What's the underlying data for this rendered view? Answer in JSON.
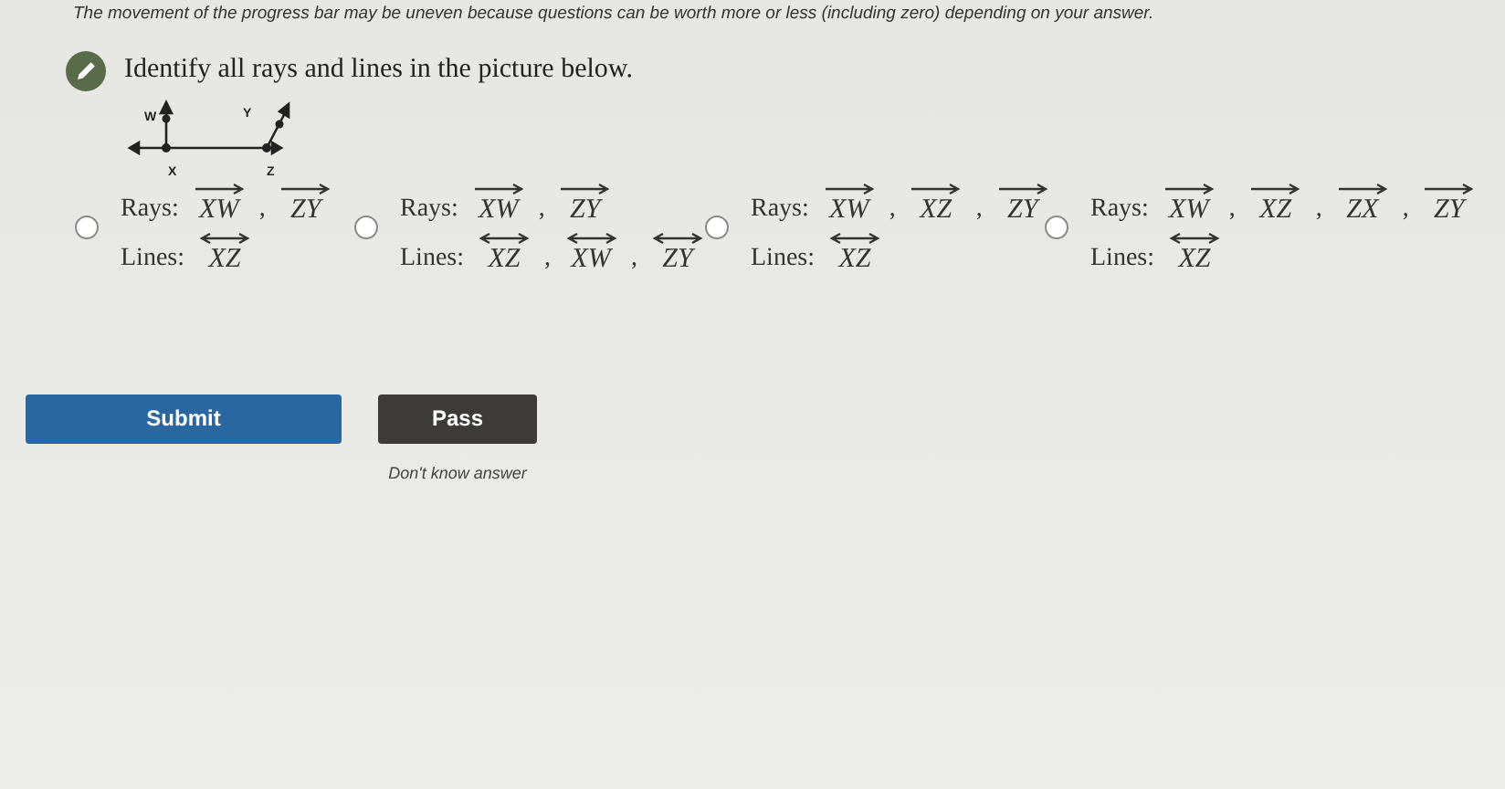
{
  "notice": "The movement of the progress bar may be uneven because questions can be worth more or less (including zero) depending on your answer.",
  "question": "Identify all rays and lines in the picture below.",
  "figure": {
    "labels": [
      "W",
      "Y",
      "X",
      "Z"
    ]
  },
  "separator": ",",
  "options": [
    {
      "selected": false,
      "rows": [
        {
          "label": "Rays:",
          "items": [
            {
              "name": "XW",
              "kind": "ray"
            },
            {
              "name": "ZY",
              "kind": "ray"
            }
          ]
        },
        {
          "label": "Lines:",
          "items": [
            {
              "name": "XZ",
              "kind": "line"
            }
          ]
        }
      ]
    },
    {
      "selected": false,
      "rows": [
        {
          "label": "Rays:",
          "items": [
            {
              "name": "XW",
              "kind": "ray"
            },
            {
              "name": "ZY",
              "kind": "ray"
            }
          ]
        },
        {
          "label": "Lines:",
          "items": [
            {
              "name": "XZ",
              "kind": "line"
            },
            {
              "name": "XW",
              "kind": "line"
            },
            {
              "name": "ZY",
              "kind": "line"
            }
          ]
        }
      ]
    },
    {
      "selected": false,
      "rows": [
        {
          "label": "Rays:",
          "items": [
            {
              "name": "XW",
              "kind": "ray"
            },
            {
              "name": "XZ",
              "kind": "ray"
            },
            {
              "name": "ZY",
              "kind": "ray"
            }
          ]
        },
        {
          "label": "Lines:",
          "items": [
            {
              "name": "XZ",
              "kind": "line"
            }
          ]
        }
      ]
    },
    {
      "selected": false,
      "rows": [
        {
          "label": "Rays:",
          "items": [
            {
              "name": "XW",
              "kind": "ray"
            },
            {
              "name": "XZ",
              "kind": "ray"
            },
            {
              "name": "ZX",
              "kind": "ray"
            },
            {
              "name": "ZY",
              "kind": "ray"
            }
          ]
        },
        {
          "label": "Lines:",
          "items": [
            {
              "name": "XZ",
              "kind": "line"
            }
          ]
        }
      ]
    }
  ],
  "buttons": [
    {
      "label": "Submit",
      "kind": "primary"
    },
    {
      "label": "Pass",
      "kind": "secondary"
    }
  ],
  "pass_hint": "Don't know answer"
}
